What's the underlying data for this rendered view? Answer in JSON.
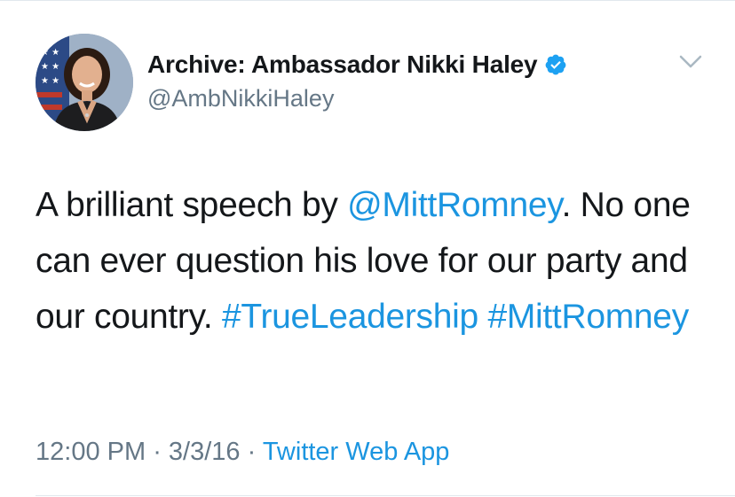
{
  "author": {
    "display_name": "Archive: Ambassador Nikki Haley",
    "handle": "@AmbNikkiHaley",
    "verified_icon": "verified-badge-icon",
    "avatar_icon": "profile-photo"
  },
  "tweet": {
    "text_part1": "A brilliant speech by ",
    "mention": "@MittRomney",
    "text_part2": ". No one can ever question his love for our party and our country. ",
    "hashtag1": "#TrueLeadership",
    "hashtag2": "#MittRomney"
  },
  "meta": {
    "time": "12:00 PM",
    "separator1": " · ",
    "date": "3/3/16",
    "separator2": " · ",
    "source": "Twitter Web App"
  },
  "colors": {
    "link": "#1b95e0",
    "secondary_text": "#657786",
    "primary_text": "#14171a",
    "divider": "#e1e8ed"
  }
}
